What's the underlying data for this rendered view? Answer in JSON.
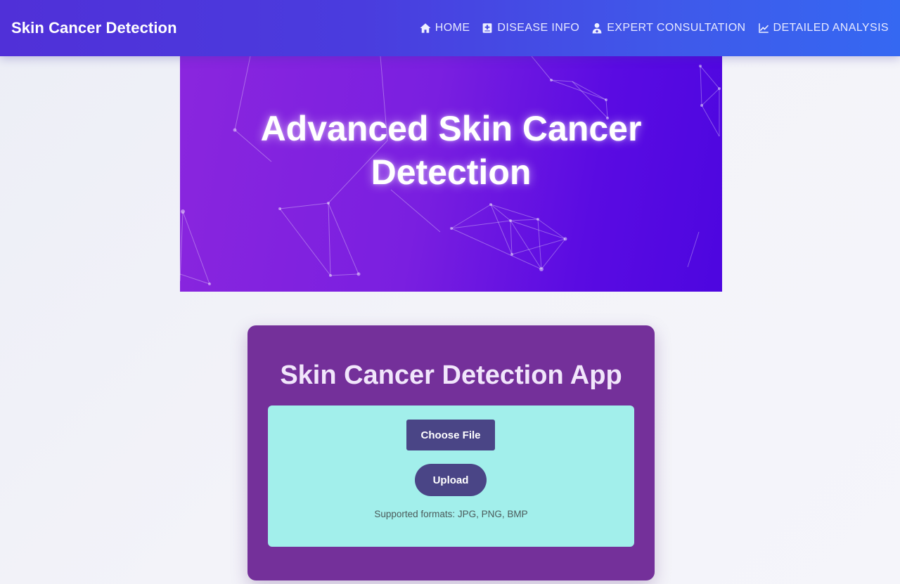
{
  "navbar": {
    "brand": "Skin Cancer Detection",
    "items": [
      {
        "label": "HOME",
        "icon": "home-icon"
      },
      {
        "label": "DISEASE INFO",
        "icon": "medical-file-icon"
      },
      {
        "label": "EXPERT CONSULTATION",
        "icon": "doctor-icon"
      },
      {
        "label": "DETAILED ANALYSIS",
        "icon": "chart-line-icon"
      }
    ]
  },
  "hero": {
    "title_line1": "Advanced Skin Cancer",
    "title_line2": "Detection"
  },
  "app": {
    "title": "Skin Cancer Detection App",
    "choose_file_label": "Choose File",
    "upload_label": "Upload",
    "formats_text": "Supported formats: JPG, PNG, BMP"
  },
  "colors": {
    "nav_start": "#5030d8",
    "nav_end": "#3568f2",
    "hero_start": "#8a26de",
    "hero_end": "#4d06e0",
    "card_bg": "#74309a",
    "panel_bg": "#a2efeb",
    "button_bg": "#4a4586"
  }
}
